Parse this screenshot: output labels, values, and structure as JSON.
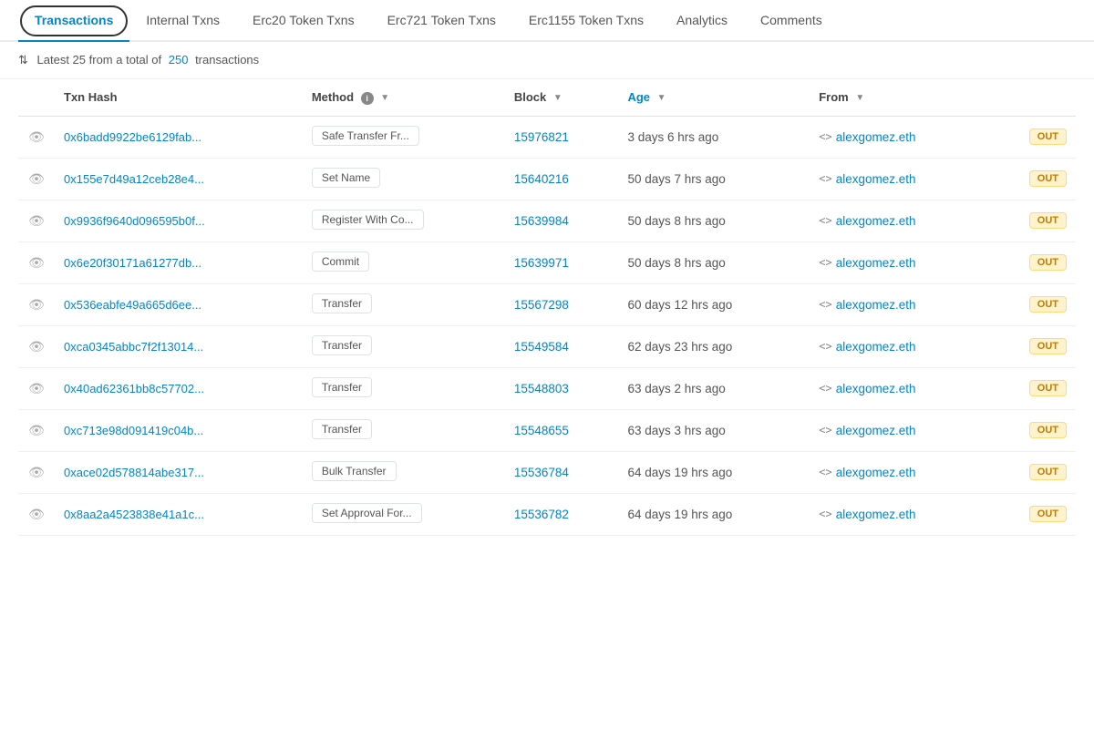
{
  "tabs": [
    {
      "id": "transactions",
      "label": "Transactions",
      "active": true
    },
    {
      "id": "internal-txns",
      "label": "Internal Txns",
      "active": false
    },
    {
      "id": "erc20",
      "label": "Erc20 Token Txns",
      "active": false
    },
    {
      "id": "erc721",
      "label": "Erc721 Token Txns",
      "active": false
    },
    {
      "id": "erc1155",
      "label": "Erc1155 Token Txns",
      "active": false
    },
    {
      "id": "analytics",
      "label": "Analytics",
      "active": false
    },
    {
      "id": "comments",
      "label": "Comments",
      "active": false
    }
  ],
  "summary": {
    "text": "Latest 25 from a total of",
    "count": "250",
    "suffix": "transactions"
  },
  "columns": {
    "txn_hash": "Txn Hash",
    "method": "Method",
    "block": "Block",
    "age": "Age",
    "from": "From"
  },
  "rows": [
    {
      "hash": "0x6badd9922be6129fab...",
      "method": "Safe Transfer Fr...",
      "block": "15976821",
      "age": "3 days 6 hrs ago",
      "from": "alexgomez.eth",
      "direction": "OUT"
    },
    {
      "hash": "0x155e7d49a12ceb28e4...",
      "method": "Set Name",
      "block": "15640216",
      "age": "50 days 7 hrs ago",
      "from": "alexgomez.eth",
      "direction": "OUT"
    },
    {
      "hash": "0x9936f9640d096595b0f...",
      "method": "Register With Co...",
      "block": "15639984",
      "age": "50 days 8 hrs ago",
      "from": "alexgomez.eth",
      "direction": "OUT"
    },
    {
      "hash": "0x6e20f30171a61277db...",
      "method": "Commit",
      "block": "15639971",
      "age": "50 days 8 hrs ago",
      "from": "alexgomez.eth",
      "direction": "OUT"
    },
    {
      "hash": "0x536eabfe49a665d6ee...",
      "method": "Transfer",
      "block": "15567298",
      "age": "60 days 12 hrs ago",
      "from": "alexgomez.eth",
      "direction": "OUT"
    },
    {
      "hash": "0xca0345abbc7f2f13014...",
      "method": "Transfer",
      "block": "15549584",
      "age": "62 days 23 hrs ago",
      "from": "alexgomez.eth",
      "direction": "OUT"
    },
    {
      "hash": "0x40ad62361bb8c57702...",
      "method": "Transfer",
      "block": "15548803",
      "age": "63 days 2 hrs ago",
      "from": "alexgomez.eth",
      "direction": "OUT"
    },
    {
      "hash": "0xc713e98d091419c04b...",
      "method": "Transfer",
      "block": "15548655",
      "age": "63 days 3 hrs ago",
      "from": "alexgomez.eth",
      "direction": "OUT"
    },
    {
      "hash": "0xace02d578814abe317...",
      "method": "Bulk Transfer",
      "block": "15536784",
      "age": "64 days 19 hrs ago",
      "from": "alexgomez.eth",
      "direction": "OUT"
    },
    {
      "hash": "0x8aa2a4523838e41a1c...",
      "method": "Set Approval For...",
      "block": "15536782",
      "age": "64 days 19 hrs ago",
      "from": "alexgomez.eth",
      "direction": "OUT"
    }
  ],
  "labels": {
    "out": "OUT",
    "sort_icon": "⇅",
    "filter_icon": "▼",
    "info_icon": "i",
    "eye": "👁",
    "contract": "<>"
  }
}
